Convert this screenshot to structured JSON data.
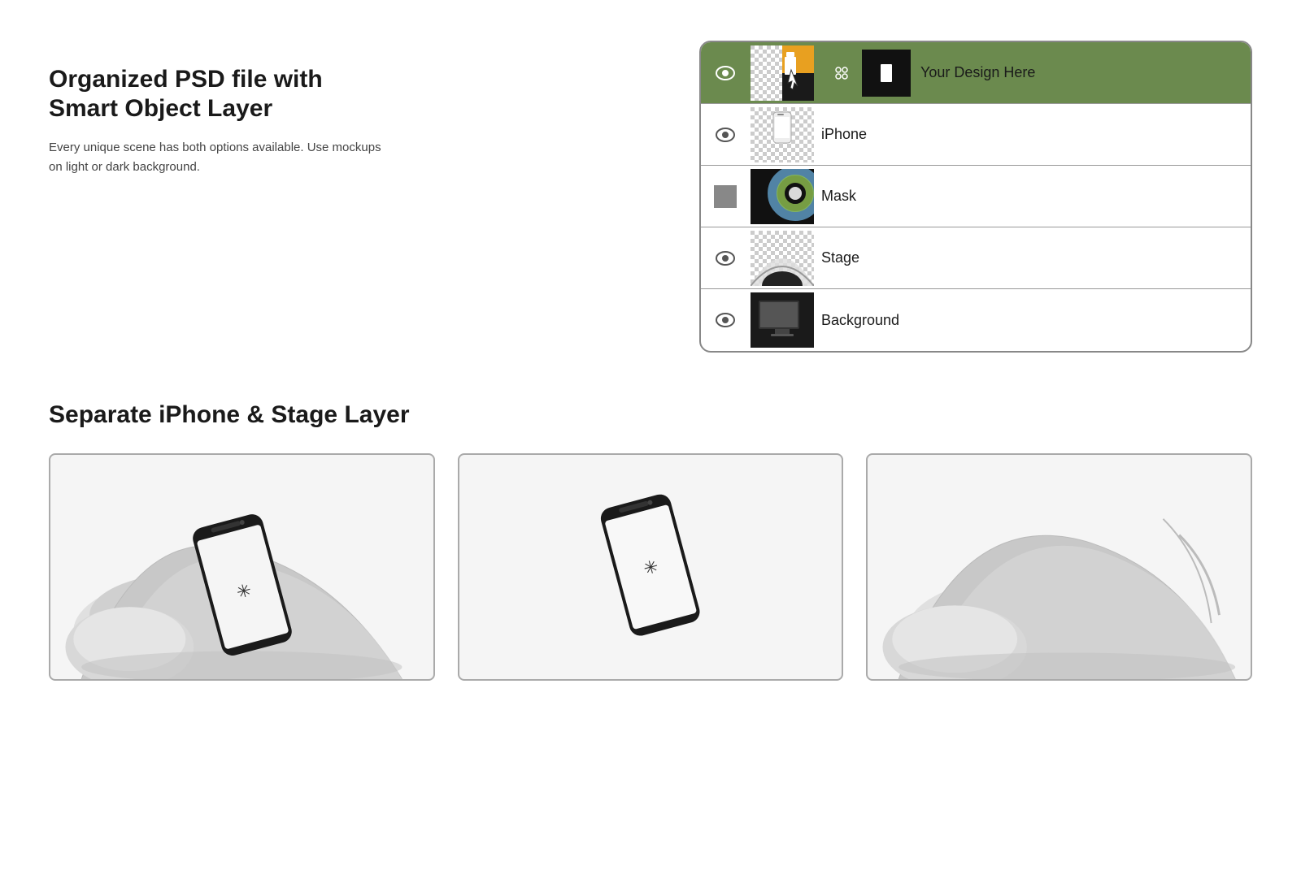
{
  "top": {
    "heading": "Organized PSD file with Smart Object Layer",
    "description": "Every unique scene has both options available. Use mockups on light or dark background."
  },
  "layers": [
    {
      "id": "your-design",
      "name": "Your Design Here",
      "eye": true,
      "active": true,
      "thumb_type": "design"
    },
    {
      "id": "iphone",
      "name": "iPhone",
      "eye": true,
      "active": false,
      "thumb_type": "iphone"
    },
    {
      "id": "mask",
      "name": "Mask",
      "eye": false,
      "active": false,
      "thumb_type": "mask"
    },
    {
      "id": "stage",
      "name": "Stage",
      "eye": true,
      "active": false,
      "thumb_type": "stage"
    },
    {
      "id": "background",
      "name": "Background",
      "eye": true,
      "active": false,
      "thumb_type": "background"
    }
  ],
  "bottom": {
    "heading": "Separate iPhone & Stage Layer"
  },
  "cards": [
    {
      "id": "card-full",
      "type": "full"
    },
    {
      "id": "card-phone-only",
      "type": "phone-only"
    },
    {
      "id": "card-stage-only",
      "type": "stage-only"
    }
  ]
}
